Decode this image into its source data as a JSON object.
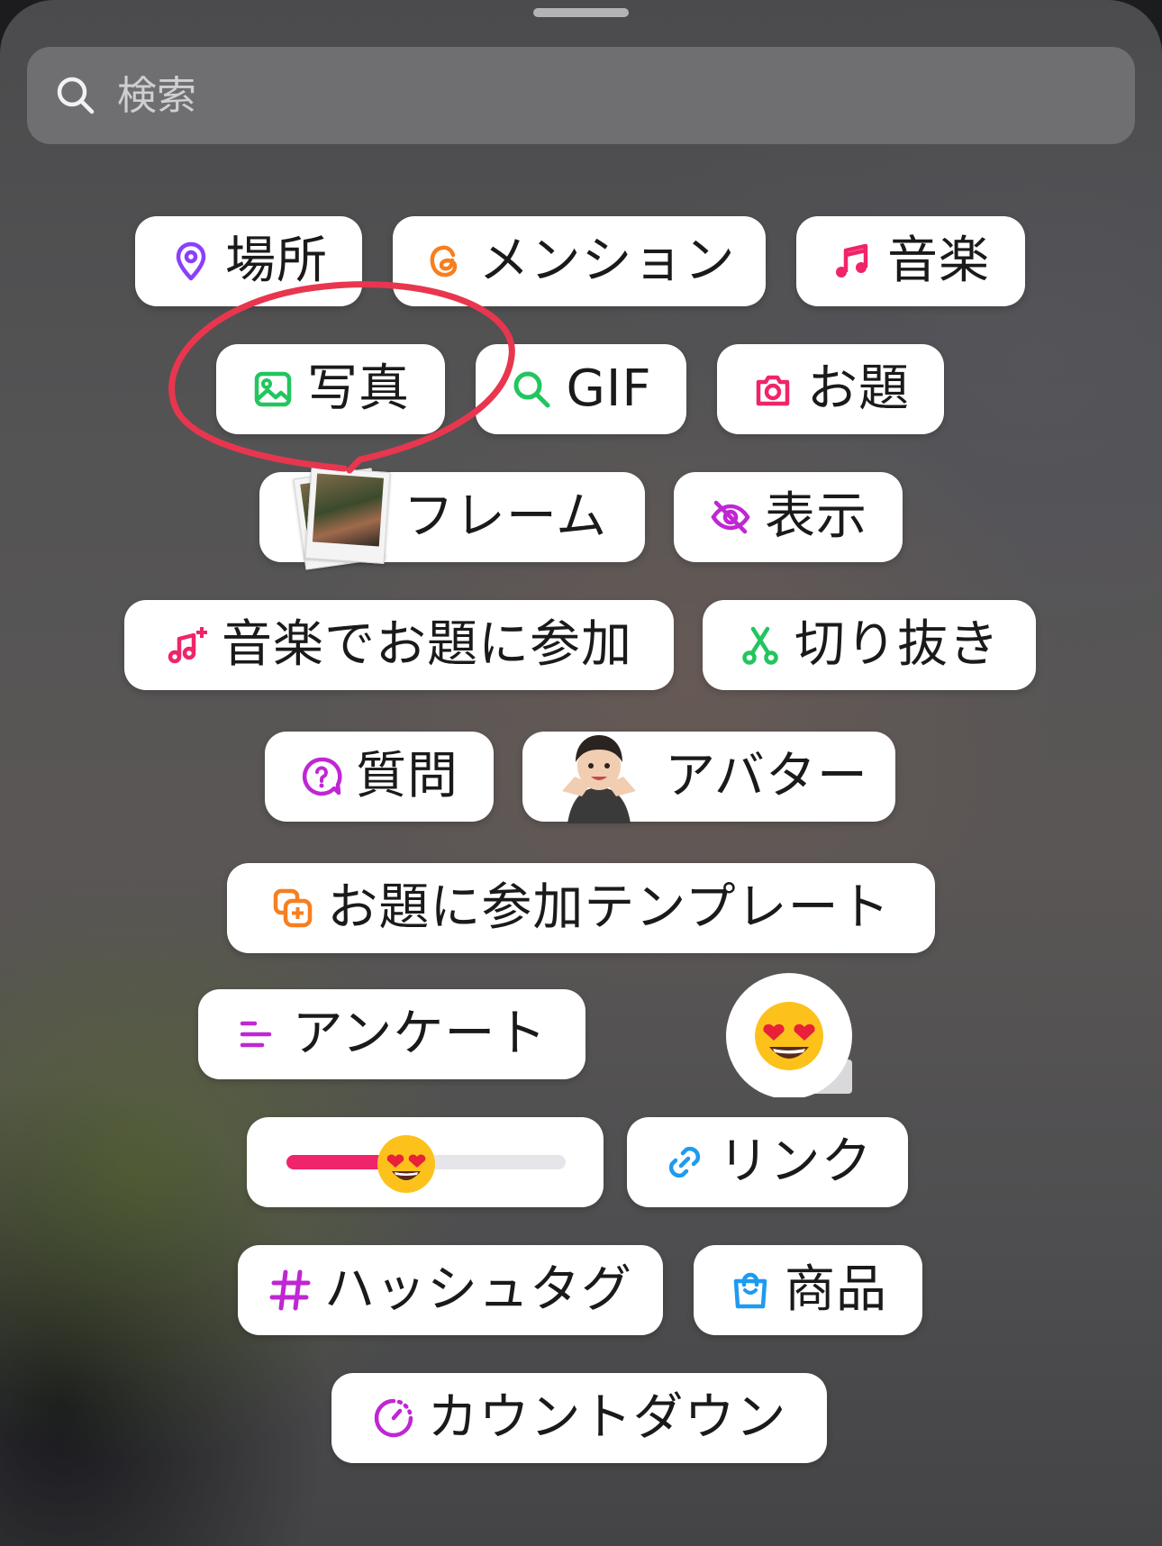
{
  "search": {
    "placeholder": "検索"
  },
  "stickers": {
    "location": "場所",
    "mention": "メンション",
    "music": "音楽",
    "photo": "写真",
    "gif": "GIF",
    "prompt": "お題",
    "frame": "フレーム",
    "reveal": "表示",
    "add_yours_music": "音楽でお題に参加",
    "cutout": "切り抜き",
    "questions": "質問",
    "avatar": "アバター",
    "add_yours_template": "お題に参加テンプレート",
    "poll": "アンケート",
    "link": "リンク",
    "hashtag": "ハッシュタグ",
    "product": "商品",
    "countdown": "カウントダウン"
  },
  "emoji_slider": {
    "value": 0.43
  },
  "colors": {
    "purple": "#8a3ffc",
    "orange": "#f77f1f",
    "pink": "#f0246a",
    "green": "#22c55e",
    "magenta": "#c026d3",
    "blue": "#1d9bf0",
    "annotation_red": "#e8364f"
  }
}
